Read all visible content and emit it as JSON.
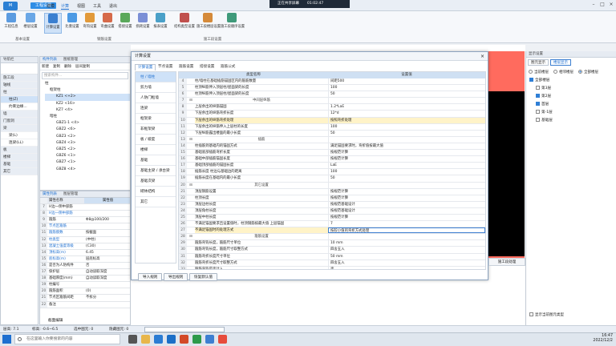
{
  "app": {
    "project_tab": "工程设置",
    "menus": [
      "建模",
      "计算",
      "视图",
      "工具",
      "退出"
    ],
    "active_menu": "计算",
    "recorder": {
      "label": "正在共享屏幕",
      "time": "01:02:47"
    }
  },
  "ribbon": {
    "buttons": [
      "工程信息",
      "楼层设置",
      "计算设置",
      "比重设置",
      "弯钩设置",
      "弯曲设置",
      "搭接设置",
      "损耗设置",
      "报表设置",
      "结构类型设置",
      "施工段楼层设置",
      "施工段顺序设置"
    ],
    "groups": [
      "基本设置",
      "钢筋设置",
      "施工段设置"
    ]
  },
  "nav": {
    "title": "导航栏",
    "items": [
      "施工段",
      "轴线",
      "柱",
      "柱(Z)",
      "约束边缘...",
      "墙",
      "门窗洞",
      "梁",
      "梁(L)",
      "连梁(LL)",
      "板",
      "楼梯",
      "基础",
      "其它"
    ]
  },
  "component_list": {
    "tabs": [
      "构件列表",
      "图纸管理"
    ],
    "toolbar": [
      "新建",
      "复制",
      "删除",
      "层间复制"
    ],
    "search_placeholder": "搜索构件...",
    "tree": [
      "柱",
      "框架柱",
      "KZ1 <+2>",
      "KZ2 <16>",
      "KZ7 <4>",
      "暗柱",
      "GBZ1-1 <4>",
      "GBZ2 <6>",
      "GBZ3 <2>",
      "GBZ4 <3>",
      "GBZ5 <2>",
      "GBZ6 <1>",
      "GBZ7 <1>",
      "GBZ8 <4>"
    ]
  },
  "props": {
    "tabs": [
      "属性列表",
      "图层管理"
    ],
    "col_name": "属性名称",
    "col_value": "属性值",
    "rows": [
      {
        "n": "7",
        "k": "H边一侧中部筋",
        "v": ""
      },
      {
        "n": "8",
        "k": "H边一侧中部筋",
        "v": ""
      },
      {
        "n": "9",
        "k": "箍筋",
        "v": "Φ8@100/200"
      },
      {
        "n": "10",
        "k": "节点区箍筋",
        "v": ""
      },
      {
        "n": "11",
        "k": "箍筋肢数",
        "v": "按截面"
      },
      {
        "n": "12",
        "k": "柱类型",
        "v": "(中柱)"
      },
      {
        "n": "13",
        "k": "混凝土强度等级",
        "v": "(C30)"
      },
      {
        "n": "14",
        "k": "顶标高(m)",
        "v": "6.45"
      },
      {
        "n": "15",
        "k": "底标高(m)",
        "v": "层底标高"
      },
      {
        "n": "16",
        "k": "是否为人防构件",
        "v": "否"
      },
      {
        "n": "17",
        "k": "保护层",
        "v": "自动读取深度"
      },
      {
        "n": "18",
        "k": "基础厚度(mm)",
        "v": "自动读取深度"
      },
      {
        "n": "19",
        "k": "柱编号",
        "v": ""
      },
      {
        "n": "20",
        "k": "箍筋面积",
        "v": "(0)"
      },
      {
        "n": "21",
        "k": "节点区箍筋间距",
        "v": "不拆分"
      },
      {
        "n": "22",
        "k": "备注",
        "v": ""
      }
    ],
    "footer": "截面编辑"
  },
  "dialog": {
    "title": "计算设置",
    "tabs": [
      "计算设置",
      "节点设置",
      "箍筋设置",
      "搭接设置",
      "箍筋公式"
    ],
    "categories": [
      "柱 / 墙柱",
      "剪力墙",
      "人防门框墙",
      "连梁",
      "框架梁",
      "非框架梁",
      "板 / 坡度",
      "楼梯",
      "基础",
      "基础主梁 / 承台梁",
      "基础次梁",
      "砌体结构",
      "其它"
    ],
    "col_type": "类型名称",
    "col_value": "设置值",
    "rows": [
      {
        "n": "4",
        "k": "柱/墙柱在基础插筋锚固区内的箍筋数量",
        "v": "间距500",
        "g": false
      },
      {
        "n": "5",
        "k": "柱顶纵筋伸入顶层柱/屋面梁的长度",
        "v": "100",
        "g": false
      },
      {
        "n": "6",
        "k": "柱顶纵筋伸入顶层柱/屋面梁的长度",
        "v": "50",
        "g": false
      },
      {
        "n": "7",
        "k": "中间层纵筋",
        "v": "",
        "g": true
      },
      {
        "n": "8",
        "k": "上层余出的纵筋锚固",
        "v": "1.2*LaE",
        "g": false
      },
      {
        "n": "9",
        "k": "下层余出的纵筋弯折长度",
        "v": "12*d",
        "g": false
      },
      {
        "n": "10",
        "k": "下层余出的纵筋弯折处理",
        "v": "按照弯折处理",
        "g": false,
        "hl": true
      },
      {
        "n": "11",
        "k": "下层余出的纵筋伸入上层柱的长度",
        "v": "100",
        "g": false
      },
      {
        "n": "12",
        "k": "下层纵筋露出楼面的最小长度",
        "v": "50",
        "g": false
      },
      {
        "n": "13",
        "k": "插筋",
        "v": "",
        "g": true
      },
      {
        "n": "14",
        "k": "柱插筋到基础内的锚固方式",
        "v": "满足锚固要求时，弯折值按最大值",
        "g": false
      },
      {
        "n": "15",
        "k": "基础底部插筋弯折长度",
        "v": "按规范计算",
        "g": false
      },
      {
        "n": "16",
        "k": "基础中部插筋锚固长度",
        "v": "按规范计算",
        "g": false
      },
      {
        "n": "17",
        "k": "基础顶部插筋的锚固长度",
        "v": "LaE",
        "g": false
      },
      {
        "n": "18",
        "k": "插筋长度 柱边与基础边的距离",
        "v": "100",
        "g": false
      },
      {
        "n": "19",
        "k": "插筋长度在基础内的最小长度",
        "v": "50",
        "g": false
      },
      {
        "n": "20",
        "k": "其它设置",
        "v": "",
        "g": true
      },
      {
        "n": "21",
        "k": "顶层钢筋设置",
        "v": "按规范计算",
        "g": false
      },
      {
        "n": "22",
        "k": "柱顶长度",
        "v": "按规范计算",
        "g": false
      },
      {
        "n": "23",
        "k": "顶层边柱长度",
        "v": "按规范基础设计",
        "g": false
      },
      {
        "n": "24",
        "k": "顶层角柱长度",
        "v": "按规范基础设计",
        "g": false
      },
      {
        "n": "25",
        "k": "顶层中柱长度",
        "v": "按规范计算",
        "g": false
      },
      {
        "n": "26",
        "k": "不满足锚固要求且设置值时，柱顶钢筋按最大值 上层锚固",
        "v": "7",
        "g": false
      },
      {
        "n": "27",
        "k": "不满足锚固时的处理方式",
        "v": "按较小值的弯折方式处理",
        "g": false,
        "sel": true
      },
      {
        "n": "28",
        "k": "箍筋设置",
        "v": "",
        "g": true
      },
      {
        "n": "29",
        "k": "箍筋弯钩长度，箍筋尺寸单位",
        "v": "10 mm",
        "g": false
      },
      {
        "n": "30",
        "k": "箍筋弯钩长度，箍筋尺寸取整方式",
        "v": "四舍五入",
        "g": false
      },
      {
        "n": "31",
        "k": "箍筋弯折长度尺寸单位",
        "v": "50 mm",
        "g": false
      },
      {
        "n": "32",
        "k": "箍筋弯折长度尺寸取整方式",
        "v": "四舍五入",
        "g": false
      },
      {
        "n": "33",
        "k": "箍筋弯钩是否计入",
        "v": "否",
        "g": false
      }
    ],
    "buttons": [
      "导入规则",
      "导出规则",
      "恢复默认值"
    ],
    "extra_btn": "施工段处理"
  },
  "right_panel": {
    "title": "显示设置",
    "tabs": [
      "图元显示",
      "楼层显示"
    ],
    "radios": [
      "当前楼层",
      "相邻楼层",
      "全部楼层"
    ],
    "floors": [
      {
        "name": "全部楼层",
        "on": true
      },
      {
        "name": "第3层",
        "on": false
      },
      {
        "name": "第2层",
        "on": true
      },
      {
        "name": "首层",
        "on": true
      },
      {
        "name": "第-1层",
        "on": false
      },
      {
        "name": "基础层",
        "on": false
      }
    ],
    "footer": "显示当前图元类型"
  },
  "status": {
    "floor": "层高: 7.1",
    "elev": "标高: -0.6~6.5",
    "selected": "选中图元: 0",
    "hidden": "隐藏图元: 0"
  },
  "taskbar": {
    "search_placeholder": "在这里输入你要搜索的内容",
    "clock_time": "16:47",
    "clock_date": "2022/12/2"
  },
  "colors": {
    "accent": "#2f8ee6",
    "canvas_red": "#ff6b5e",
    "highlight": "#fff3c8"
  }
}
